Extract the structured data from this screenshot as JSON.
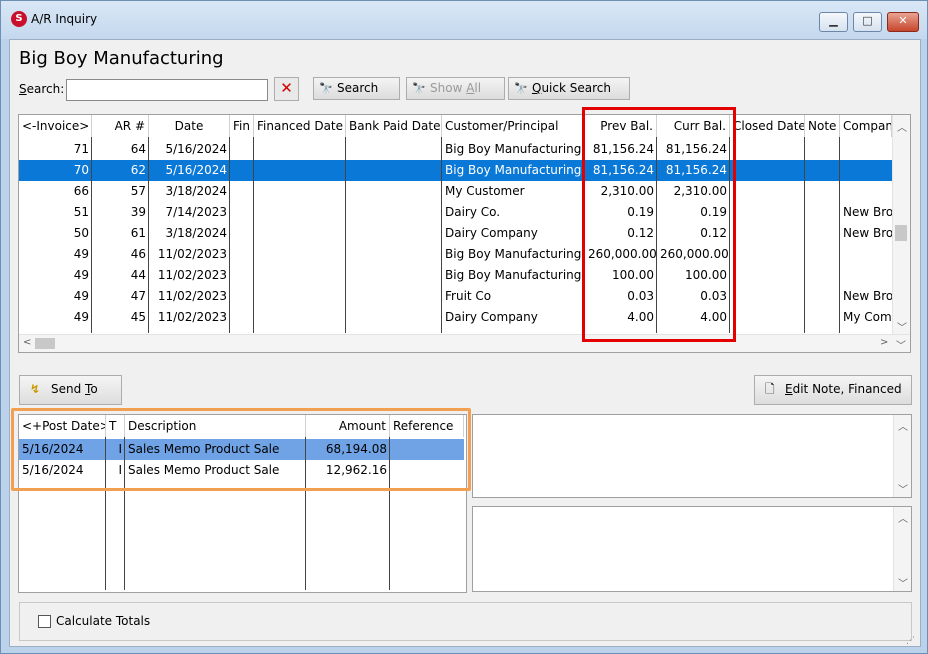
{
  "window": {
    "title": "A/R Inquiry",
    "app_icon": "S",
    "minimize": "▁",
    "maximize": "□",
    "close": "✕"
  },
  "company_name": "Big Boy Manufacturing",
  "search": {
    "label_underlined": "S",
    "label_rest": "earch:",
    "value": "",
    "clear_glyph": "✕"
  },
  "toolbar": {
    "search_label": "Search",
    "show_all_underlined": "A",
    "show_all_pre": "Show ",
    "show_all_post": "ll",
    "quick_search_underlined": "Q",
    "quick_search_post": "uick Search"
  },
  "invoice_grid": {
    "headers": [
      "<-Invoice>",
      "AR #",
      "Date",
      "Fin",
      "Financed Date",
      "Bank Paid Date",
      "Customer/Principal",
      "Prev Bal.",
      "Curr Bal.",
      "Closed Date",
      "Note",
      "Company"
    ],
    "rows": [
      {
        "invoice": "71",
        "ar": "64",
        "date": "5/16/2024",
        "customer": "Big Boy Manufacturing",
        "prev": "81,156.24",
        "curr": "81,156.24",
        "company": ""
      },
      {
        "invoice": "70",
        "ar": "62",
        "date": "5/16/2024",
        "customer": "Big Boy Manufacturing",
        "prev": "81,156.24",
        "curr": "81,156.24",
        "company": ""
      },
      {
        "invoice": "66",
        "ar": "57",
        "date": "3/18/2024",
        "customer": "My Customer",
        "prev": "2,310.00",
        "curr": "2,310.00",
        "company": ""
      },
      {
        "invoice": "51",
        "ar": "39",
        "date": "7/14/2023",
        "customer": "Dairy Co.",
        "prev": "0.19",
        "curr": "0.19",
        "company": "New Brok"
      },
      {
        "invoice": "50",
        "ar": "61",
        "date": "3/18/2024",
        "customer": "Dairy Company",
        "prev": "0.12",
        "curr": "0.12",
        "company": "New Brok"
      },
      {
        "invoice": "49",
        "ar": "46",
        "date": "11/02/2023",
        "customer": "Big Boy Manufacturing",
        "prev": "260,000.00",
        "curr": "260,000.00",
        "company": ""
      },
      {
        "invoice": "49",
        "ar": "44",
        "date": "11/02/2023",
        "customer": "Big Boy Manufacturing",
        "prev": "100.00",
        "curr": "100.00",
        "company": ""
      },
      {
        "invoice": "49",
        "ar": "47",
        "date": "11/02/2023",
        "customer": "Fruit Co",
        "prev": "0.03",
        "curr": "0.03",
        "company": "New Brok"
      },
      {
        "invoice": "49",
        "ar": "45",
        "date": "11/02/2023",
        "customer": "Dairy Company",
        "prev": "4.00",
        "curr": "4.00",
        "company": "My Comp"
      }
    ],
    "selected_index": 1
  },
  "send_to": {
    "pre": "Send ",
    "underlined": "T",
    "post": "o"
  },
  "edit_note": {
    "pre": "",
    "underlined": "E",
    "post": "dit Note, Financed"
  },
  "post_grid": {
    "headers": [
      "<+Post Date>",
      "T",
      "Description",
      "Amount",
      "Reference"
    ],
    "rows": [
      {
        "post_date": "5/16/2024",
        "t": "I",
        "description": "Sales Memo Product Sale",
        "amount": "68,194.08",
        "reference": ""
      },
      {
        "post_date": "5/16/2024",
        "t": "I",
        "description": "Sales Memo Product Sale",
        "amount": "12,962.16",
        "reference": ""
      }
    ],
    "selected_index": 0
  },
  "calculate_totals": {
    "label": "Calculate Totals",
    "checked": false
  },
  "colors": {
    "selection": "#0a78d7",
    "post_selection": "#6fa3e6",
    "highlight_red": "#e20000",
    "highlight_orange": "#f0a050"
  }
}
